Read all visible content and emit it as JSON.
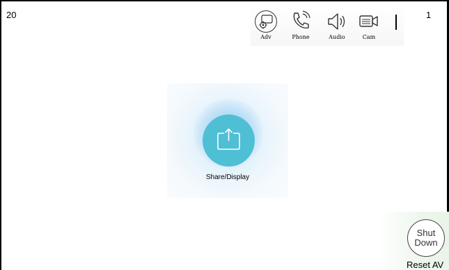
{
  "status": {
    "left_number": "20",
    "right_number": "1"
  },
  "toolbar": {
    "items": [
      {
        "label": "Adv",
        "icon": "gear-chat-icon"
      },
      {
        "label": "Phone",
        "icon": "phone-icon"
      },
      {
        "label": "Audio",
        "icon": "speaker-icon"
      },
      {
        "label": "Cam",
        "icon": "camera-icon"
      }
    ]
  },
  "main": {
    "share_label": "Share/Display",
    "share_icon": "share-screen-icon"
  },
  "footer": {
    "shutdown_line1": "Shut",
    "shutdown_line2": "Down",
    "reset_label": "Reset AV"
  },
  "colors": {
    "accent": "#4fbfd6",
    "glow": "#cfe9f8"
  }
}
